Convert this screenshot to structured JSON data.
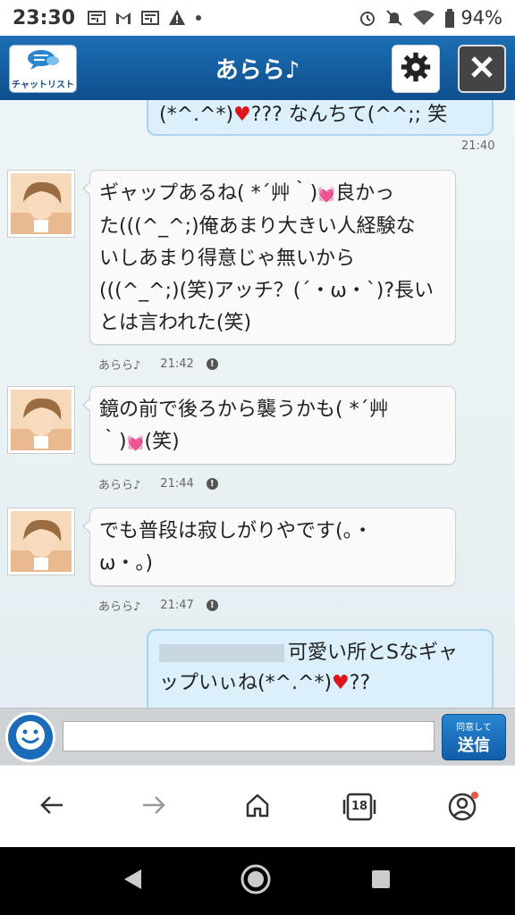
{
  "status_bar": {
    "time": "23:30",
    "battery": "94%"
  },
  "header": {
    "title": "あらら♪",
    "chat_list_label": "チャットリスト"
  },
  "colors": {
    "header": "#1d6fb5",
    "outgoing_bubble": "#dcf0fb",
    "incoming_bubble": "#fafafa",
    "heart": "#e0151b"
  },
  "messages": [
    {
      "direction": "out",
      "text_a": "(*^.^*)",
      "text_b": "??? なんちて(^^;; ",
      "text_c": "笑",
      "time": "21:40"
    },
    {
      "direction": "in",
      "sender": "あらら♪",
      "time": "21:42",
      "text_1": "ギャップあるね( *´艸｀)",
      "text_2": "良かっ",
      "text_3": "た(((^_^;)俺あまり大きい人経験な",
      "text_4": "いしあまり得意じゃ無いから",
      "text_5": "(((^_^;)(笑)アッチ？(´・ω・`)?長い",
      "text_6": "とは言われた(笑)"
    },
    {
      "direction": "in",
      "sender": "あらら♪",
      "time": "21:44",
      "text_1": "鏡の前で後ろから襲うかも( *´艸",
      "text_2": "｀)",
      "text_3": "(笑)"
    },
    {
      "direction": "in",
      "sender": "あらら♪",
      "time": "21:47",
      "text_1": "でも普段は寂しがりやです(。・",
      "text_2": "ω・。)"
    },
    {
      "direction": "out",
      "text_1": "可愛い所とSなギャ",
      "text_2": "ップいぃね(*^.^*)",
      "text_3": "??"
    }
  ],
  "input": {
    "placeholder": "",
    "send_small": "同意して",
    "send_big": "送信"
  },
  "browser_nav": {
    "tab_count": "18"
  }
}
